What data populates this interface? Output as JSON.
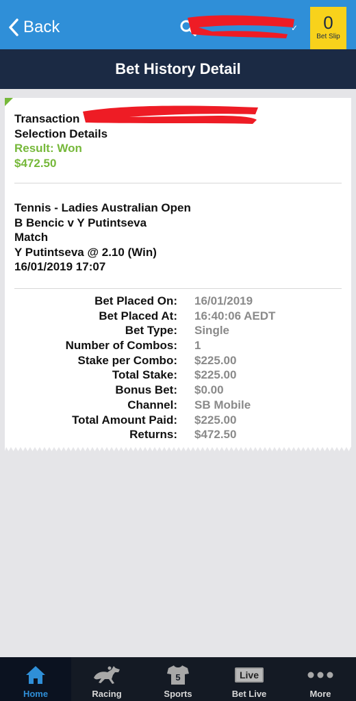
{
  "header": {
    "back_label": "Back",
    "bet_slip_count": "0",
    "bet_slip_label": "Bet Slip",
    "title": "Bet History Detail"
  },
  "summary": {
    "transaction_label": "Transaction",
    "selection_details": "Selection Details",
    "result": "Result: Won",
    "amount": "$472.50"
  },
  "selection": {
    "competition": "Tennis - Ladies Australian Open",
    "event": "B Bencic v Y Putintseva",
    "market": "Match",
    "pick": "Y Putintseva @ 2.10 (Win)",
    "datetime": "16/01/2019 17:07"
  },
  "details": [
    {
      "label": "Bet Placed On:",
      "value": "16/01/2019"
    },
    {
      "label": "Bet Placed At:",
      "value": "16:40:06 AEDT"
    },
    {
      "label": "Bet Type:",
      "value": "Single"
    },
    {
      "label": "Number of Combos:",
      "value": "1"
    },
    {
      "label": "Stake per Combo:",
      "value": "$225.00"
    },
    {
      "label": "Total Stake:",
      "value": "$225.00"
    },
    {
      "label": "Bonus Bet:",
      "value": "$0.00"
    },
    {
      "label": "Channel:",
      "value": "SB Mobile"
    },
    {
      "label": "Total Amount Paid:",
      "value": "$225.00"
    },
    {
      "label": "Returns:",
      "value": "$472.50"
    }
  ],
  "tabs": [
    {
      "label": "Home",
      "icon": "home-icon",
      "active": true
    },
    {
      "label": "Racing",
      "icon": "horse-racing-icon",
      "active": false
    },
    {
      "label": "Sports",
      "icon": "jersey-icon",
      "active": false
    },
    {
      "label": "Bet Live",
      "icon": "live-icon",
      "live_text": "Live",
      "active": false
    },
    {
      "label": "More",
      "icon": "more-dots-icon",
      "active": false
    }
  ],
  "jersey_number": "5",
  "colors": {
    "header_blue": "#2f8fd8",
    "navy": "#1b2a44",
    "won_green": "#76b83a",
    "bet_slip_yellow": "#f8d21b",
    "redaction_red": "#ee1c25"
  }
}
